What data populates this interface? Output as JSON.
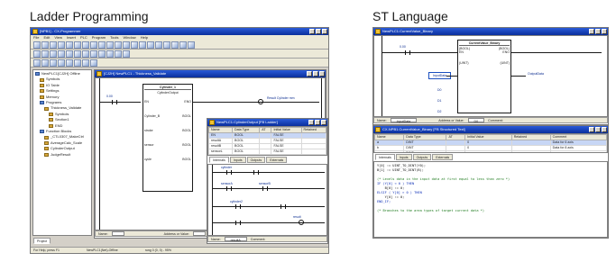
{
  "captions": {
    "ladder": "Ladder Programming",
    "st": "ST Language"
  },
  "ladder_ide": {
    "title": "[NPB1] - CX-Programmer",
    "menu": [
      "File",
      "Edit",
      "View",
      "Insert",
      "PLC",
      "Program",
      "Tools",
      "Window",
      "Help"
    ],
    "tree": [
      "NewPLC1[CJ2H] Offline",
      "Symbols",
      "IO Table",
      "Settings",
      "Memory",
      "Programs",
      "Thickness_Validate",
      "Symbols",
      "Section1",
      "END",
      "Function Blocks",
      "_CTL0307_MakeCtrl",
      "AverageCalc_Scale",
      "CylinderOutput",
      "JudgeResult"
    ],
    "ladder_tab": "[CJ2H] NewPLC1 - Thickness_Validate",
    "fb_block": "Cylinder_1",
    "fb_type": "CylinderOutput",
    "output_label": "Result Cylinder mm",
    "fb_rows": [
      {
        "in": "EN",
        "out": "ENO"
      },
      {
        "in": "Cylinder_B",
        "out": "BOOL"
      },
      {
        "in": "stroke",
        "out": "BOOL"
      },
      {
        "in": "sensor",
        "out": "BOOL"
      },
      {
        "in": "cycle",
        "out": "BOOL"
      }
    ],
    "status_left": "For Help, press F1",
    "status_mid": "NewPLC1(Net)-Offline",
    "status_right": "rung 0 (0, 0) - 95%",
    "sub_window": {
      "title": "NewPLC1.CylinderOutput [FB Ladder]",
      "columns": [
        "Name",
        "Data Type",
        "AT",
        "Initial Value",
        "Retained"
      ],
      "rows": [
        [
          "EN",
          "BOOL",
          "",
          "FALSE",
          ""
        ],
        [
          "resultA",
          "BOOL",
          "",
          "FALSE",
          ""
        ],
        [
          "resultB",
          "BOOL",
          "",
          "FALSE",
          ""
        ],
        [
          "sensorL",
          "BOOL",
          "",
          "FALSE",
          ""
        ],
        [
          "sensorR",
          "BOOL",
          "",
          "FALSE",
          ""
        ]
      ],
      "tabs": [
        "Internals",
        "Inputs",
        "Outputs",
        "Externals"
      ],
      "rung_labels": [
        "cylinder",
        "sensorA",
        "sensorB",
        "cylinder2",
        "result"
      ],
      "infobar_name": "Name:",
      "infobar_name_value": "resultA",
      "infobar_addr": "Address or Value:",
      "infobar_comment": "Comment:"
    },
    "bottom_name": "Name:",
    "bottom_addr": "Address or Value:",
    "project_tab": "Project"
  },
  "st_ide": {
    "top_window_title": "NewPLC1.CurrentValue_Binary",
    "block_title": "CurrentValue_Binary",
    "labels": [
      "0.00",
      "InputData",
      "D0",
      "D1",
      "D2",
      "OutputData"
    ],
    "ports": [
      "(BOOL)",
      "EN",
      "(BOOL)",
      "ENO",
      "(UINT)",
      "(UINT)"
    ],
    "top_infobar": {
      "name": "Name:",
      "name_value": "InputData",
      "addr": "Address or Value:",
      "addr_value": "D0",
      "comment": "Comment:"
    },
    "bottom_window_title": "CX-NPB1.CurrentValue_Binary [FB Structured Text]",
    "columns": [
      "Name",
      "Data Type",
      "AT",
      "Initial Value",
      "Retained",
      "Comment"
    ],
    "rows": [
      [
        "a",
        "DINT",
        "",
        "0",
        "",
        "Data for 6 axis"
      ],
      [
        "b",
        "DINT",
        "",
        "0",
        "",
        "Data for 8 axis"
      ],
      [
        "c",
        "DINT",
        "",
        "",
        "",
        ""
      ]
    ],
    "tabs": [
      "Internals",
      "Inputs",
      "Outputs",
      "Externals"
    ],
    "code": [
      {
        "c": "tx",
        "t": "Y[0] := UINT_TO_DINT(Y0);"
      },
      {
        "c": "tx",
        "t": "B[1] := UINT_TO_DINT(B);"
      },
      {
        "c": "tx",
        "t": ""
      },
      {
        "c": "cm",
        "t": "(* Levels data in the input data at first equal to less than zero *)"
      },
      {
        "c": "kw",
        "t": "IF (Y[0] < 0 ) THEN"
      },
      {
        "c": "tx",
        "t": "    B[0] := 0;"
      },
      {
        "c": "kw",
        "t": "ELSIF ( Y[0] > 0 ) THEN"
      },
      {
        "c": "tx",
        "t": "    Y[0] := 0;"
      },
      {
        "c": "kw",
        "t": "END_IF;"
      },
      {
        "c": "tx",
        "t": ""
      },
      {
        "c": "cm",
        "t": "(* Branches to the area types of target current data *)"
      }
    ]
  }
}
